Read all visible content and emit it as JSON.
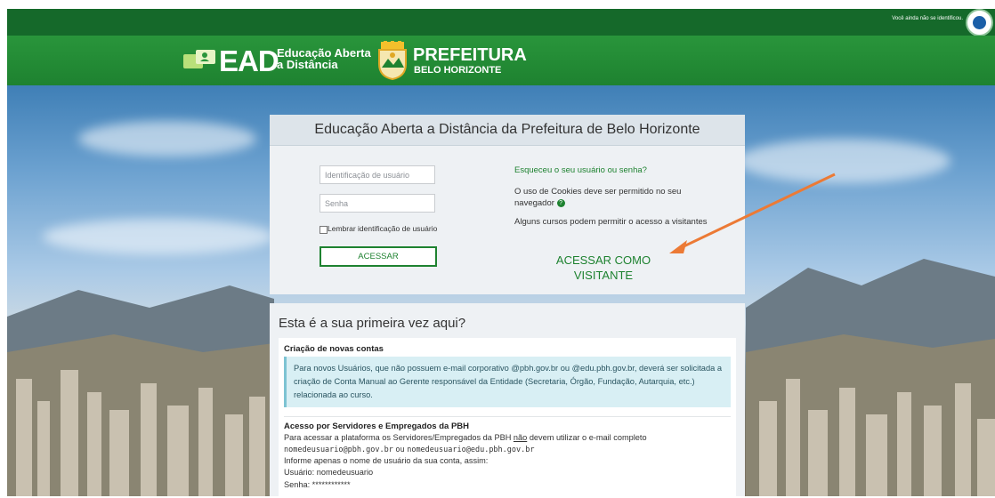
{
  "header": {
    "not_identified": "Você ainda não se identificou.",
    "ead_logo_text": "EAD",
    "ead_logo_sub1": "Educação Aberta",
    "ead_logo_sub2": "a Distância",
    "pref_title": "PREFEITURA",
    "pref_subtitle": "BELO HORIZONTE"
  },
  "login": {
    "title": "Educação Aberta a Distância da Prefeitura de Belo Horizonte",
    "username_placeholder": "Identificação de usuário",
    "password_placeholder": "Senha",
    "remember_label": "Lembrar identificação de usuário",
    "submit_label": "ACESSAR",
    "forgot_link": "Esqueceu o seu usuário ou senha?",
    "cookies_text": "O uso de Cookies deve ser permitido no seu navegador",
    "guests_text": "Alguns cursos podem permitir o acesso a visitantes",
    "guest_button": "ACESSAR COMO VISITANTE"
  },
  "first_time": {
    "title": "Esta é a sua primeira vez aqui?",
    "section1_title": "Criação de novas contas",
    "section1_alert": "Para novos Usuários, que não possuem e-mail corporativo @pbh.gov.br ou @edu.pbh.gov.br, deverá ser solicitada a criação de Conta Manual  ao Gerente responsável da Entidade (Secretaria, Órgão, Fundação, Autarquia, etc.) relacionada ao curso.",
    "section2_title": "Acesso por Servidores e Empregados da PBH",
    "line1_start": "Para acessar a plataforma os Servidores/Empregados da PBH",
    "line1_emph": "não",
    "line1_end": "devem utilizar o e-mail completo",
    "email1": "nomedeusuario@pbh.gov.br",
    "email_or": "ou",
    "email2": "nomedeusuario@edu.pbh.gov.br",
    "line3": "Informe apenas o nome de usuário da sua conta, assim:",
    "line4": "Usuário: nomedeusuario",
    "line5": "Senha:  ************"
  },
  "colors": {
    "brand_green": "#1e8230",
    "top_green": "#15692a",
    "alert_bg": "#d8eff4",
    "arrow": "#ec7a35"
  },
  "icons": [
    "ead-logo-icon",
    "prefeitura-crest-icon",
    "help-icon",
    "user-avatar-icon",
    "annotation-arrow"
  ]
}
